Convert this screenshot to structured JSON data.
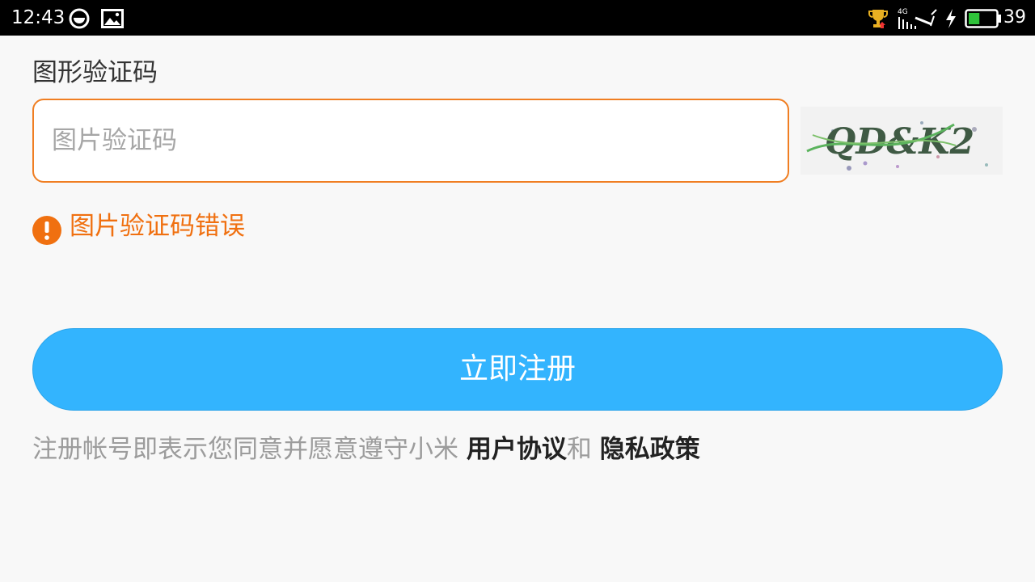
{
  "status_bar": {
    "time": "12:43",
    "network_label": "4G",
    "battery_level": "39",
    "battery_fraction": 0.39,
    "icons": [
      "qq-icon",
      "gallery-icon",
      "trophy-icon",
      "signal-icon",
      "charging-icon",
      "battery-icon"
    ],
    "battery_color": "#2fc23a"
  },
  "form": {
    "captcha_label": "图形验证码",
    "captcha_placeholder": "图片验证码",
    "captcha_value": "",
    "captcha_image_text": "QD&K2",
    "error_message": "图片验证码错误",
    "error_color": "#f07010",
    "accent_border": "#f07e22"
  },
  "actions": {
    "register_label": "立即注册",
    "button_color": "#33b4fe"
  },
  "agreement": {
    "prefix": "注册帐号即表示您同意并愿意遵守小米 ",
    "user_agreement": "用户协议",
    "conjunction": "和 ",
    "privacy_policy": "隐私政策"
  }
}
